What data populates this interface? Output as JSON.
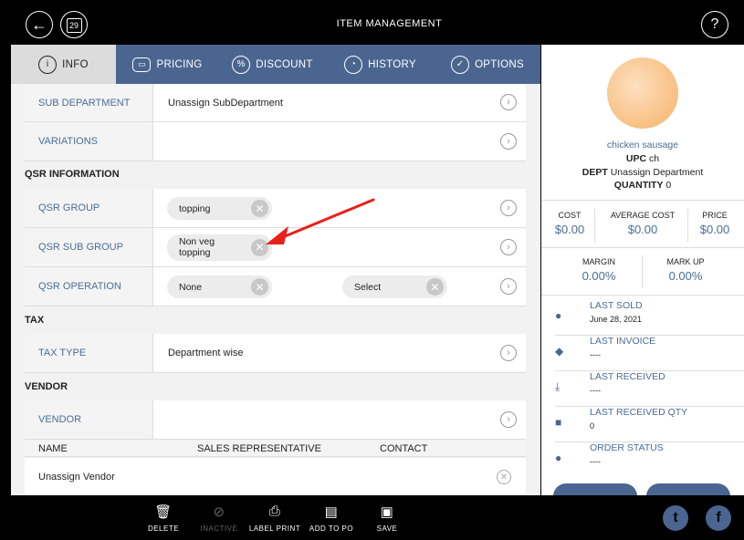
{
  "header": {
    "title": "ITEM MANAGEMENT",
    "calendar_day": "29",
    "back_icon": "back-arrow-icon",
    "help": "?"
  },
  "tabs": [
    {
      "label": "INFO",
      "icon": "i"
    },
    {
      "label": "PRICING",
      "icon": "▭"
    },
    {
      "label": "DISCOUNT",
      "icon": "%"
    },
    {
      "label": "HISTORY",
      "icon": "◔"
    },
    {
      "label": "OPTIONS",
      "icon": "✓"
    }
  ],
  "form": {
    "sub_department": {
      "label": "SUB DEPARTMENT",
      "value": "Unassign SubDepartment"
    },
    "variations": {
      "label": "VARIATIONS",
      "value": ""
    },
    "qsr_section": "QSR INFORMATION",
    "qsr_group": {
      "label": "QSR GROUP",
      "value": "topping"
    },
    "qsr_sub_group": {
      "label": "QSR SUB GROUP",
      "value_line1": "Non veg",
      "value_line2": "topping"
    },
    "qsr_operation": {
      "label": "QSR OPERATION",
      "value": "None",
      "select": "Select"
    },
    "tax_section": "TAX",
    "tax_type": {
      "label": "TAX TYPE",
      "value": "Department wise"
    },
    "vendor_section": "VENDOR",
    "vendor": {
      "label": "VENDOR",
      "value": ""
    },
    "vendor_table": {
      "headers": [
        "NAME",
        "SALES REPRESENTATIVE",
        "CONTACT"
      ],
      "rows": [
        {
          "name": "Unassign Vendor"
        }
      ]
    }
  },
  "summary": {
    "name": "chicken sausage",
    "upc_label": "UPC",
    "upc": "ch",
    "dept_label": "DEPT",
    "dept": "Unassign Department",
    "qty_label": "QUANTITY",
    "qty": "0",
    "cost_label": "COST",
    "cost": "$0.00",
    "avg_cost_label": "AVERAGE COST",
    "avg_cost": "$0.00",
    "price_label": "PRICE",
    "price": "$0.00",
    "margin_label": "MARGIN",
    "margin": "0.00%",
    "markup_label": "MARK UP",
    "markup": "0.00%"
  },
  "recent": [
    {
      "title": "LAST SOLD",
      "value": "June 28, 2021",
      "icon": "bag-icon"
    },
    {
      "title": "LAST INVOICE",
      "value": "----",
      "icon": "stack-icon"
    },
    {
      "title": "LAST RECEIVED",
      "value": "----",
      "icon": "tray-download-icon"
    },
    {
      "title": "LAST RECEIVED QTY",
      "value": "0",
      "icon": "box-icon"
    },
    {
      "title": "ORDER STATUS",
      "value": "----",
      "icon": "stopwatch-icon"
    }
  ],
  "bottom": [
    {
      "label": "DELETE",
      "icon": "trash-icon"
    },
    {
      "label": "INACTIVE",
      "icon": "inactive-icon"
    },
    {
      "label": "LABEL PRINT",
      "icon": "printer-icon"
    },
    {
      "label": "ADD TO PO",
      "icon": "po-icon"
    },
    {
      "label": "SAVE",
      "icon": "save-icon"
    }
  ],
  "colors": {
    "accent": "#4a6690",
    "label_blue": "#4a6d96",
    "annotation_arrow": "#e8211c"
  }
}
